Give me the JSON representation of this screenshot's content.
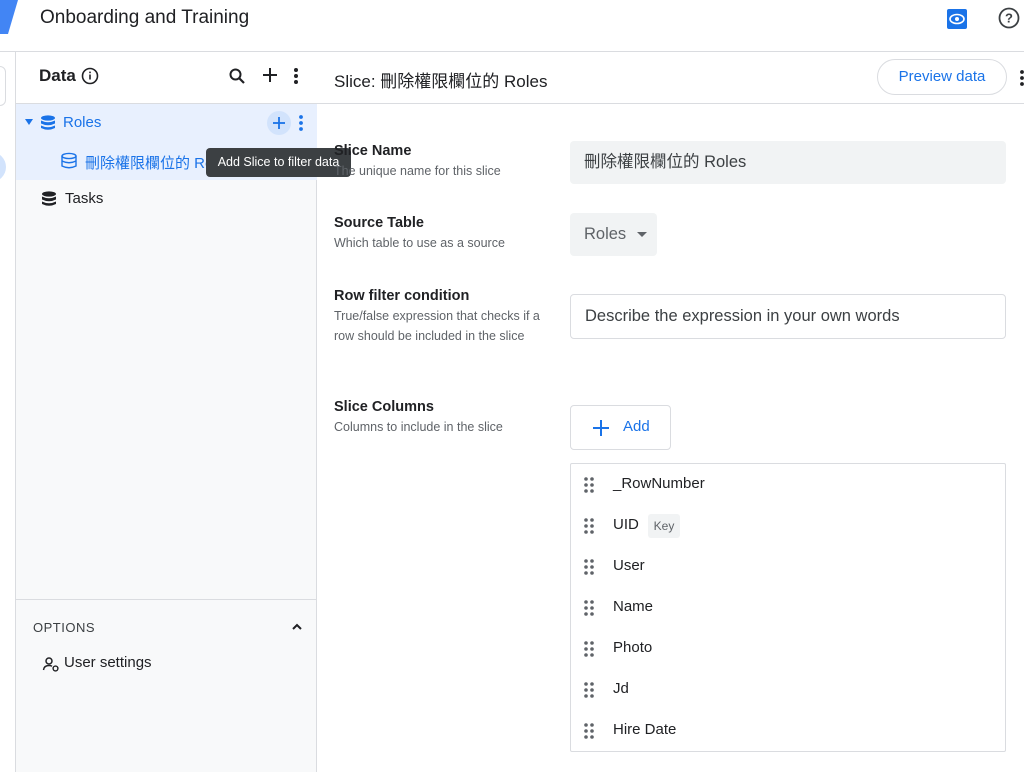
{
  "app": {
    "title": "Onboarding and Training"
  },
  "data_panel": {
    "title": "Data",
    "tables": [
      {
        "label": "Roles",
        "slices": [
          {
            "label": "刪除權限欄位的 Roles"
          }
        ]
      },
      {
        "label": "Tasks"
      }
    ],
    "tooltip": "Add Slice to filter data",
    "options": {
      "title": "OPTIONS",
      "items": [
        {
          "label": "User settings"
        }
      ]
    }
  },
  "main": {
    "title": "Slice: 刪除權限欄位的 Roles",
    "preview_label": "Preview data",
    "fields": {
      "slice_name": {
        "label": "Slice Name",
        "desc": "The unique name for this slice",
        "value": "刪除權限欄位的 Roles"
      },
      "source_table": {
        "label": "Source Table",
        "desc": "Which table to use as a source",
        "value": "Roles"
      },
      "row_filter": {
        "label": "Row filter condition",
        "desc": "True/false expression that checks if a row should be included in the slice",
        "placeholder": "Describe the expression in your own words"
      },
      "slice_columns": {
        "label": "Slice Columns",
        "desc": "Columns to include in the slice",
        "add_label": "Add"
      }
    },
    "columns": [
      {
        "name": "_RowNumber"
      },
      {
        "name": "UID",
        "badge": "Key"
      },
      {
        "name": "User"
      },
      {
        "name": "Name"
      },
      {
        "name": "Photo"
      },
      {
        "name": "Jd"
      },
      {
        "name": "Hire Date"
      }
    ]
  },
  "colors": {
    "accent": "#1a73e8",
    "selected_bg": "#e8f0fe",
    "tooltip_bg": "#3c4043"
  }
}
